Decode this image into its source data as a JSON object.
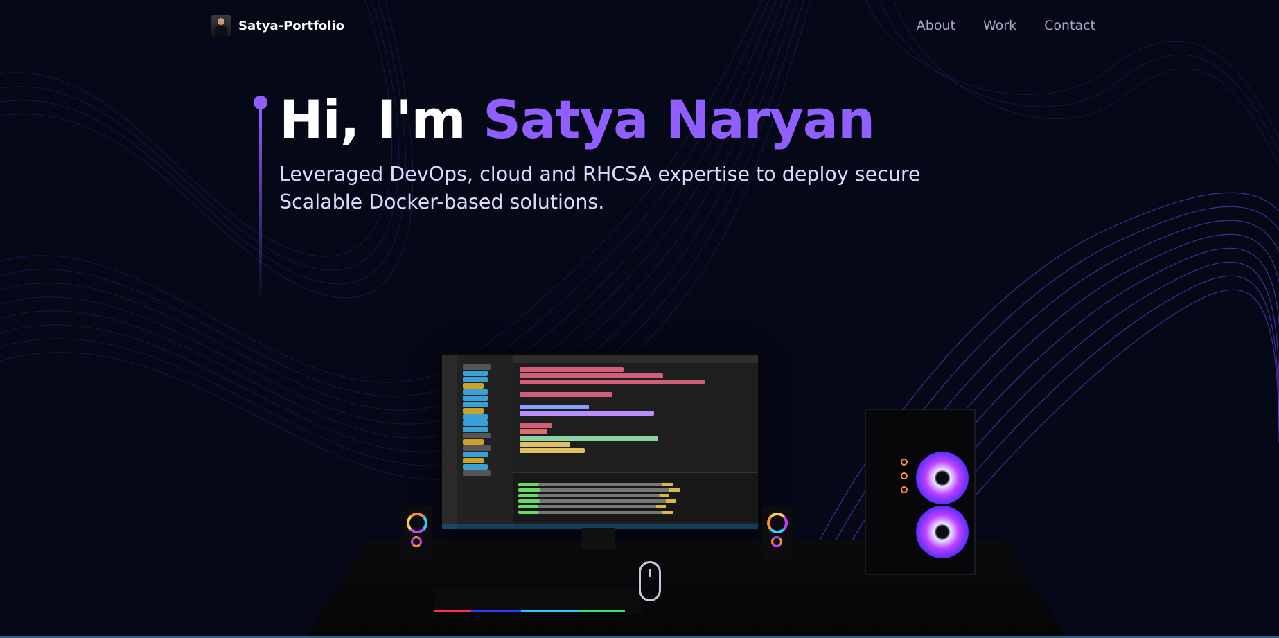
{
  "nav": {
    "brand_name": "Satya-Portfolio",
    "links": [
      {
        "label": "About"
      },
      {
        "label": "Work"
      },
      {
        "label": "Contact"
      }
    ]
  },
  "hero": {
    "greeting": "Hi, I'm ",
    "name": "Satya Naryan",
    "subtitle_line1": "Leveraged DevOps, cloud and RHCSA expertise to deploy secure",
    "subtitle_line2": "Scalable Docker-based solutions."
  },
  "colors": {
    "background": "#050816",
    "accent": "#915eff",
    "nav_link": "#aaa6c3"
  },
  "icons": [
    "avatar",
    "scroll-mouse-icon"
  ]
}
